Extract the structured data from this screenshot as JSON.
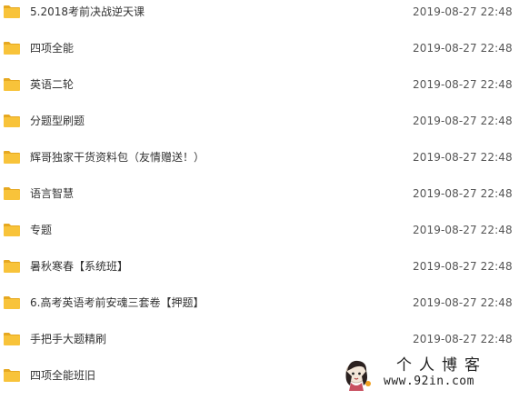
{
  "colors": {
    "folder_fill": "#F8C33A",
    "folder_tab": "#E6A820",
    "name_text": "#333333",
    "date_text": "#555555"
  },
  "files": [
    {
      "icon": "folder-icon",
      "name": "5.2018考前决战逆天课",
      "modified": "2019-08-27 22:48"
    },
    {
      "icon": "folder-icon",
      "name": "四项全能",
      "modified": "2019-08-27 22:48"
    },
    {
      "icon": "folder-icon",
      "name": "英语二轮",
      "modified": "2019-08-27 22:48"
    },
    {
      "icon": "folder-icon",
      "name": "分题型刷题",
      "modified": "2019-08-27 22:48"
    },
    {
      "icon": "folder-icon",
      "name": "辉哥独家干货资料包（友情赠送！）",
      "modified": "2019-08-27 22:48"
    },
    {
      "icon": "folder-icon",
      "name": "语言智慧",
      "modified": "2019-08-27 22:48"
    },
    {
      "icon": "folder-icon",
      "name": "专题",
      "modified": "2019-08-27 22:48"
    },
    {
      "icon": "folder-icon",
      "name": "暑秋寒春【系统班】",
      "modified": "2019-08-27 22:48"
    },
    {
      "icon": "folder-icon",
      "name": "6.高考英语考前安魂三套卷【押题】",
      "modified": "2019-08-27 22:48"
    },
    {
      "icon": "folder-icon",
      "name": "手把手大题精刷",
      "modified": "2019-08-27 22:48"
    },
    {
      "icon": "folder-icon",
      "name": "四项全能班旧",
      "modified": ""
    }
  ],
  "watermark": {
    "title": "个人博客",
    "url": "www.92in.com"
  }
}
